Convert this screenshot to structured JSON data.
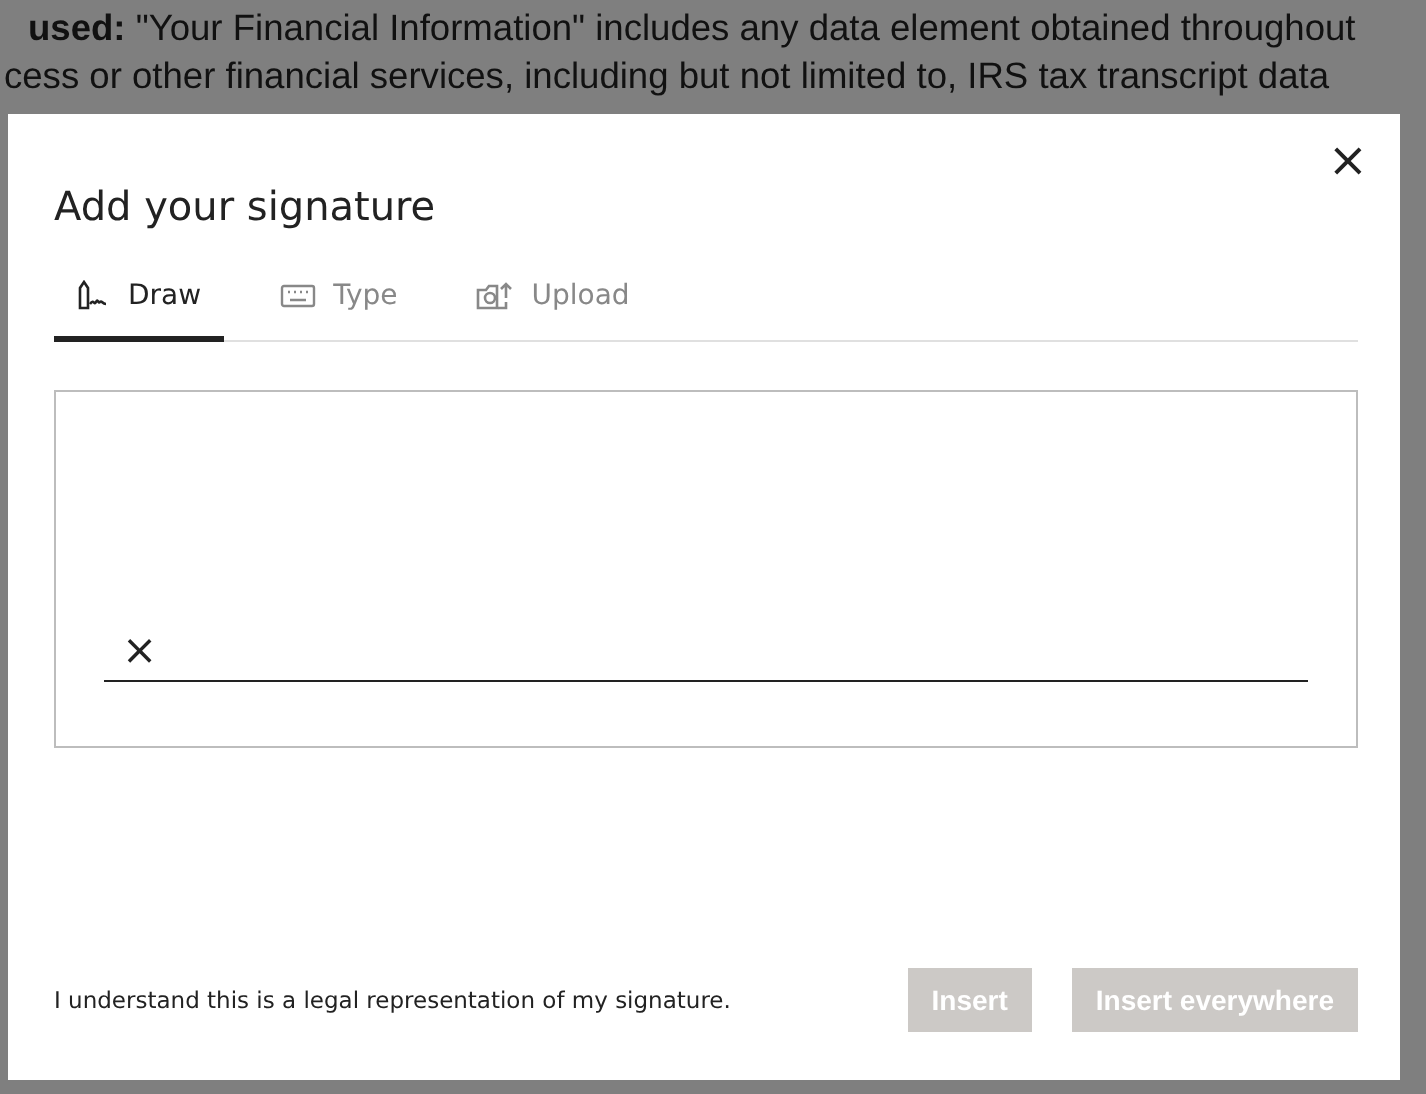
{
  "background_document": {
    "lines": [
      "**used:** \"Your Financial Information\" includes any data element obtained throughout",
      "cess or other financial services, including but not limited to, IRS tax transcript data"
    ]
  },
  "dialog": {
    "title": "Add your signature",
    "close_label": "×",
    "tabs": [
      {
        "label": "Draw",
        "kind": "draw",
        "selected": true
      },
      {
        "label": "Type",
        "kind": "type",
        "selected": false
      },
      {
        "label": "Upload",
        "kind": "upload",
        "selected": false
      }
    ],
    "signature_pad": {
      "mark": "×"
    },
    "disclaimer": "I understand this is a legal representation of my signature.",
    "buttons": [
      {
        "label": "Insert",
        "disabled": true
      },
      {
        "label": "Insert everywhere",
        "disabled": true
      }
    ]
  }
}
